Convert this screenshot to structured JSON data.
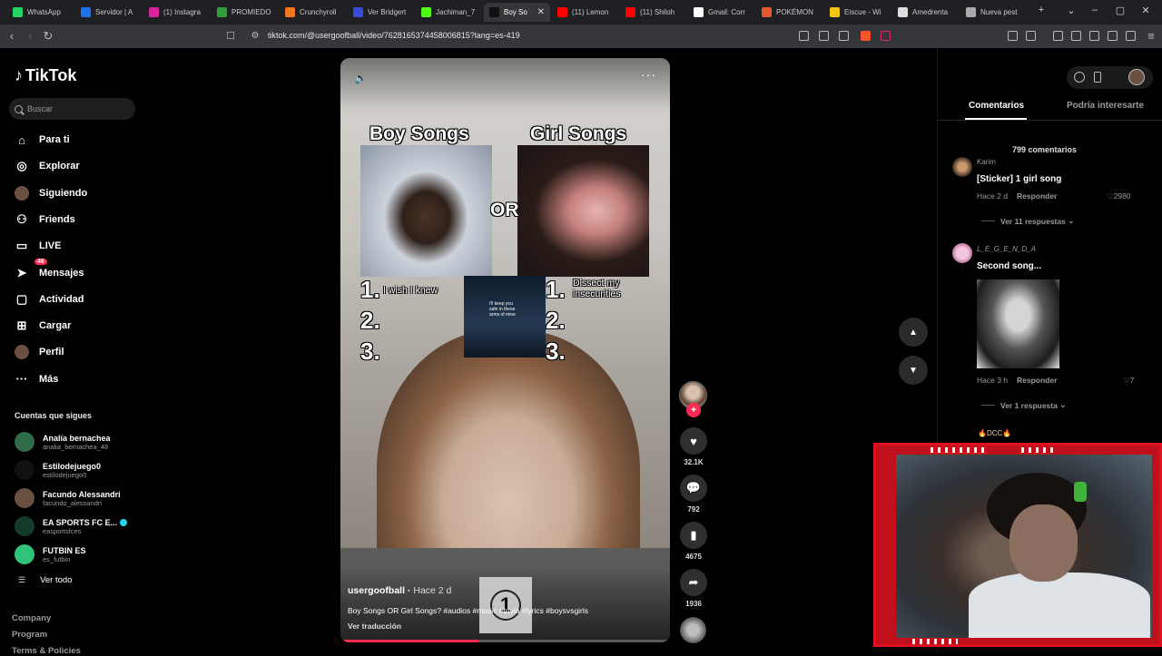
{
  "browser": {
    "tabs": [
      {
        "title": "WhatsApp",
        "color": "#25d366"
      },
      {
        "title": "Servidor | A",
        "color": "#1a73e8"
      },
      {
        "title": "(1) Instagra",
        "color": "#d6249f"
      },
      {
        "title": "PROMIEDO",
        "color": "#2e9d3a"
      },
      {
        "title": "Crunchyroll",
        "color": "#f47521"
      },
      {
        "title": "Ver Bridgert",
        "color": "#3a4bd8"
      },
      {
        "title": "Jachiman_7",
        "color": "#53fc18"
      },
      {
        "title": "Boy So",
        "color": "#111111"
      },
      {
        "title": "(11) Lemon",
        "color": "#ff0000"
      },
      {
        "title": "(11) Shiloh",
        "color": "#ff0000"
      },
      {
        "title": "Gmail: Corr",
        "color": "#ffffff"
      },
      {
        "title": "POKÉMON",
        "color": "#e05a2b"
      },
      {
        "title": "Eiscue - Wi",
        "color": "#f5c518"
      },
      {
        "title": "Amedrenta",
        "color": "#dddddd"
      },
      {
        "title": "Nueva pest",
        "color": "#aaaaaa"
      }
    ],
    "active_tab_index": 7,
    "new_tab_symbol": "+",
    "url": "tiktok.com/@usergoofball/video/7628165374458006815?lang=es-419"
  },
  "sidebar": {
    "logo": "TikTok",
    "search_placeholder": "Buscar",
    "nav": [
      {
        "label": "Para ti",
        "icon": "home-icon",
        "glyph": "⌂"
      },
      {
        "label": "Explorar",
        "icon": "compass-icon",
        "glyph": "◎"
      },
      {
        "label": "Siguiendo",
        "icon": "following-avatar-icon",
        "glyph": "●"
      },
      {
        "label": "Friends",
        "icon": "friends-icon",
        "glyph": "⚇"
      },
      {
        "label": "LIVE",
        "icon": "live-icon",
        "glyph": "▭"
      },
      {
        "label": "Mensajes",
        "icon": "messages-icon",
        "glyph": "➤",
        "badge": "46"
      },
      {
        "label": "Actividad",
        "icon": "activity-icon",
        "glyph": "▢"
      },
      {
        "label": "Cargar",
        "icon": "upload-icon",
        "glyph": "⊞"
      },
      {
        "label": "Perfil",
        "icon": "profile-avatar-icon",
        "glyph": "●"
      },
      {
        "label": "Más",
        "icon": "more-icon",
        "glyph": "···"
      }
    ],
    "following_title": "Cuentas que sigues",
    "following": [
      {
        "name": "Analía bernachea",
        "handle": "analia_bernachea_48",
        "color": "#2f6b47",
        "verified": false
      },
      {
        "name": "Estilodejuego0",
        "handle": "estilodejuego0",
        "color": "#111111",
        "verified": false
      },
      {
        "name": "Facundo Alessandri",
        "handle": "facundo_alessandri",
        "color": "#6a5043",
        "verified": false
      },
      {
        "name": "EA SPORTS FC E...",
        "handle": "easportsfces",
        "color": "#123b2a",
        "verified": true
      },
      {
        "name": "FUTBIN ES",
        "handle": "es_futbin",
        "color": "#2fc27a",
        "verified": false
      }
    ],
    "see_all": "Ver todo",
    "footer": [
      "Company",
      "Program",
      "Terms & Policies"
    ]
  },
  "video": {
    "left_title": "Boy Songs",
    "right_title": "Girl Songs",
    "or_label": "OR",
    "numbers": [
      "1.",
      "2.",
      "3."
    ],
    "left_song_1": "I wish I knew",
    "right_song_1": "Dissect my insecurities",
    "lyric_overlay": "i'll keep you safe in these arms of mine",
    "counter": "1",
    "author": "usergoofball",
    "time": "Hace 2 d",
    "caption": "Boy Songs OR Girl Songs? #audios #music #trivia #lyrics #boysvsgirls",
    "translate": "Ver traducción",
    "progress_percent": 42
  },
  "actions": {
    "likes": "32.1K",
    "comments": "792",
    "saves": "4675",
    "shares": "1936"
  },
  "right_panel": {
    "tab_comments": "Comentarios",
    "tab_other": "Podría interesarte",
    "comment_count": "799 comentarios",
    "comments": [
      {
        "user": "Karim",
        "text": "[Sticker] 1 girl song",
        "time": "Hace 2 d",
        "reply": "Responder",
        "likes": "2980",
        "more": "Ver 11 respuestas"
      },
      {
        "user": "L_E_G_E_N_D_A",
        "text": "Second song...",
        "time": "Hace 3 h",
        "reply": "Responder",
        "likes": "7",
        "more": "Ver 1 respuesta"
      },
      {
        "user": "🔥DCC🔥"
      }
    ]
  }
}
